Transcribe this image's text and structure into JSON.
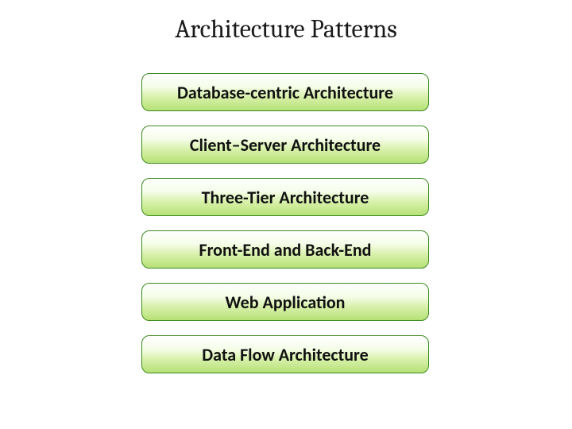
{
  "title": "Architecture Patterns",
  "items": [
    {
      "label": "Database-centric Architecture"
    },
    {
      "label": "Client–Server Architecture"
    },
    {
      "label": "Three-Tier Architecture"
    },
    {
      "label": "Front-End and Back-End"
    },
    {
      "label": "Web Application"
    },
    {
      "label": "Data Flow Architecture"
    }
  ]
}
